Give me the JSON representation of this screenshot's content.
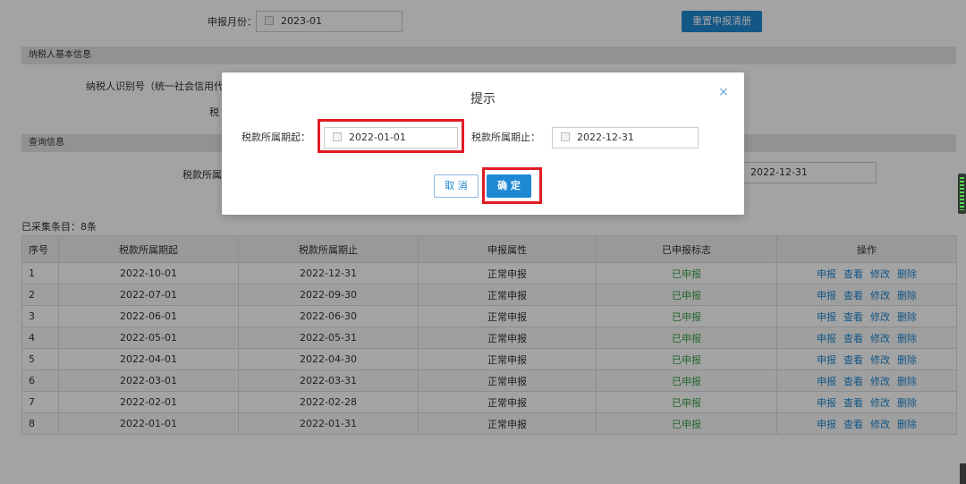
{
  "top": {
    "month_label": "申报月份：",
    "month_value": "2023-01",
    "reset_button": "重置申报清册"
  },
  "sections": {
    "basic_info": "纳税人基本信息",
    "taxpayer_id_label": "纳税人识别号（统一社会信用代",
    "tax_fragment": "税",
    "query_info": "查询信息",
    "period_fragment": "税款所属",
    "end_date_value": "2022-12-31"
  },
  "table": {
    "collected_text": "已采集条目：8条",
    "headers": [
      "序号",
      "税款所属期起",
      "税款所属期止",
      "申报属性",
      "已申报标志",
      "操作"
    ],
    "rows": [
      {
        "idx": "1",
        "start": "2022-10-01",
        "end": "2022-12-31",
        "attr": "正常申报",
        "status": "已申报"
      },
      {
        "idx": "2",
        "start": "2022-07-01",
        "end": "2022-09-30",
        "attr": "正常申报",
        "status": "已申报"
      },
      {
        "idx": "3",
        "start": "2022-06-01",
        "end": "2022-06-30",
        "attr": "正常申报",
        "status": "已申报"
      },
      {
        "idx": "4",
        "start": "2022-05-01",
        "end": "2022-05-31",
        "attr": "正常申报",
        "status": "已申报"
      },
      {
        "idx": "5",
        "start": "2022-04-01",
        "end": "2022-04-30",
        "attr": "正常申报",
        "status": "已申报"
      },
      {
        "idx": "6",
        "start": "2022-03-01",
        "end": "2022-03-31",
        "attr": "正常申报",
        "status": "已申报"
      },
      {
        "idx": "7",
        "start": "2022-02-01",
        "end": "2022-02-28",
        "attr": "正常申报",
        "status": "已申报"
      },
      {
        "idx": "8",
        "start": "2022-01-01",
        "end": "2022-01-31",
        "attr": "正常申报",
        "status": "已申报"
      }
    ],
    "actions": [
      "申报",
      "查看",
      "修改",
      "删除"
    ]
  },
  "dialog": {
    "title": "提示",
    "close": "×",
    "start_label": "税款所属期起：",
    "start_value": "2022-01-01",
    "end_label": "税款所属期止：",
    "end_value": "2022-12-31",
    "cancel": "取 消",
    "confirm": "确 定"
  },
  "colors": {
    "primary": "#1e88d4",
    "success": "#3aa04a",
    "highlight": "#e01c24"
  }
}
